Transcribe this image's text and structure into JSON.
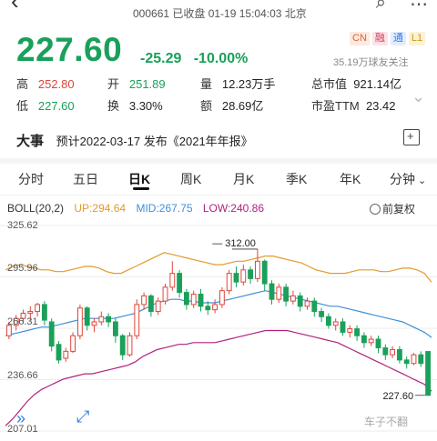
{
  "header": {
    "status_line": "000661 已收盘 01-19 15:04:03 北京",
    "back_icon": "back-arrow-icon"
  },
  "quote": {
    "price": "227.60",
    "change": "-25.29",
    "change_pct": "-10.00%",
    "badges": [
      "CN",
      "融",
      "通",
      "L1"
    ],
    "followers": "35.19万球友关注"
  },
  "stats": {
    "high_label": "高",
    "high": "252.80",
    "low_label": "低",
    "low": "227.60",
    "open_label": "开",
    "open": "251.89",
    "turnover_label": "换",
    "turnover": "3.30%",
    "volume_label": "量",
    "volume": "12.23万手",
    "amount_label": "额",
    "amount": "28.69亿",
    "mktcap_label": "总市值",
    "mktcap": "921.14亿",
    "pe_label": "市盈TTM",
    "pe": "23.42"
  },
  "events": {
    "title": "大事",
    "text": "预计2022-03-17 发布《2021年年报》"
  },
  "tabs": [
    "分时",
    "五日",
    "日K",
    "周K",
    "月K",
    "季K",
    "年K",
    "分钟"
  ],
  "active_tab": "日K",
  "boll": {
    "name": "BOLL(20,2)",
    "up": "UP:294.64",
    "mid": "MID:267.75",
    "low": "LOW:240.86",
    "adjust": "前复权"
  },
  "colors": {
    "up": "#e0453a",
    "down": "#1aa05a",
    "upper_band": "#e39a2c",
    "mid_band": "#3f8fd8",
    "lower_band": "#b0217e"
  },
  "chart_data": {
    "type": "candlestick",
    "y_ticks": [
      "325.62",
      "295.96",
      "266.31",
      "236.66",
      "207.01"
    ],
    "ylim": [
      207.01,
      325.62
    ],
    "annotation_high": "312.00",
    "annotation_last": "227.60",
    "upper_band": [
      300,
      302,
      303,
      302,
      301,
      300,
      300,
      299,
      299,
      300,
      301,
      302,
      302,
      301,
      299,
      298,
      298,
      300,
      302,
      304,
      306,
      308,
      310,
      309,
      308,
      307,
      306,
      305,
      304,
      303,
      303,
      304,
      305,
      305,
      306,
      307,
      308,
      308,
      307,
      306,
      305,
      304,
      302,
      300,
      299,
      298,
      298,
      298,
      299,
      300,
      300,
      300,
      299,
      299,
      300,
      301,
      301,
      300,
      298,
      293
    ],
    "mid_band": [
      262,
      263,
      264,
      265,
      266,
      267,
      267,
      268,
      269,
      270,
      271,
      272,
      272,
      272,
      272,
      272,
      273,
      274,
      275,
      277,
      279,
      281,
      282,
      283,
      283,
      282,
      282,
      281,
      281,
      281,
      282,
      283,
      284,
      285,
      286,
      287,
      288,
      287,
      286,
      285,
      284,
      283,
      282,
      281,
      280,
      279,
      279,
      278,
      277,
      276,
      275,
      274,
      273,
      272,
      271,
      270,
      268,
      266,
      264,
      261
    ],
    "lower_band": [
      210,
      214,
      219,
      224,
      228,
      231,
      233,
      235,
      237,
      238,
      239,
      240,
      240,
      241,
      242,
      243,
      244,
      245,
      247,
      250,
      252,
      254,
      255,
      256,
      257,
      257,
      258,
      258,
      258,
      258,
      259,
      260,
      261,
      262,
      263,
      264,
      265,
      265,
      265,
      265,
      264,
      263,
      262,
      261,
      260,
      259,
      258,
      256,
      254,
      252,
      250,
      248,
      246,
      244,
      242,
      240,
      238,
      236,
      234,
      230
    ],
    "candles": [
      [
        262,
        268,
        260,
        270
      ],
      [
        268,
        272,
        265,
        274
      ],
      [
        272,
        275,
        269,
        277
      ],
      [
        275,
        276,
        271,
        279
      ],
      [
        276,
        280,
        273,
        281
      ],
      [
        280,
        271,
        268,
        282
      ],
      [
        270,
        256,
        253,
        272
      ],
      [
        257,
        248,
        246,
        259
      ],
      [
        249,
        253,
        247,
        255
      ],
      [
        253,
        262,
        252,
        264
      ],
      [
        262,
        278,
        260,
        280
      ],
      [
        278,
        268,
        265,
        279
      ],
      [
        268,
        270,
        264,
        272
      ],
      [
        270,
        273,
        268,
        276
      ],
      [
        273,
        270,
        267,
        275
      ],
      [
        270,
        262,
        258,
        272
      ],
      [
        262,
        251,
        248,
        263
      ],
      [
        251,
        262,
        250,
        264
      ],
      [
        262,
        280,
        260,
        283
      ],
      [
        280,
        285,
        277,
        287
      ],
      [
        285,
        276,
        273,
        286
      ],
      [
        276,
        282,
        274,
        284
      ],
      [
        282,
        290,
        280,
        292
      ],
      [
        290,
        298,
        288,
        305
      ],
      [
        298,
        287,
        284,
        300
      ],
      [
        287,
        280,
        277,
        289
      ],
      [
        280,
        286,
        278,
        288
      ],
      [
        286,
        279,
        276,
        289
      ],
      [
        279,
        277,
        274,
        282
      ],
      [
        277,
        280,
        275,
        283
      ],
      [
        280,
        288,
        278,
        290
      ],
      [
        288,
        298,
        286,
        300
      ],
      [
        298,
        293,
        290,
        302
      ],
      [
        293,
        300,
        291,
        303
      ],
      [
        300,
        295,
        292,
        302
      ],
      [
        295,
        305,
        293,
        312
      ],
      [
        305,
        292,
        288,
        306
      ],
      [
        292,
        283,
        280,
        294
      ],
      [
        283,
        290,
        281,
        292
      ],
      [
        290,
        282,
        279,
        292
      ],
      [
        282,
        285,
        280,
        288
      ],
      [
        285,
        279,
        276,
        287
      ],
      [
        279,
        282,
        277,
        284
      ],
      [
        282,
        276,
        273,
        284
      ],
      [
        276,
        273,
        270,
        278
      ],
      [
        273,
        268,
        266,
        275
      ],
      [
        268,
        270,
        265,
        272
      ],
      [
        270,
        264,
        262,
        272
      ],
      [
        264,
        266,
        261,
        268
      ],
      [
        266,
        262,
        259,
        268
      ],
      [
        262,
        258,
        255,
        264
      ],
      [
        258,
        260,
        256,
        262
      ],
      [
        260,
        255,
        252,
        262
      ],
      [
        255,
        251,
        248,
        257
      ],
      [
        251,
        254,
        249,
        256
      ],
      [
        254,
        248,
        246,
        256
      ],
      [
        248,
        246,
        243,
        250
      ],
      [
        246,
        251,
        245,
        252
      ],
      [
        251,
        246,
        244,
        253
      ],
      [
        252.89,
        227.6,
        227.6,
        252.8
      ]
    ]
  },
  "footer": {
    "watermark": "车子不翻"
  }
}
